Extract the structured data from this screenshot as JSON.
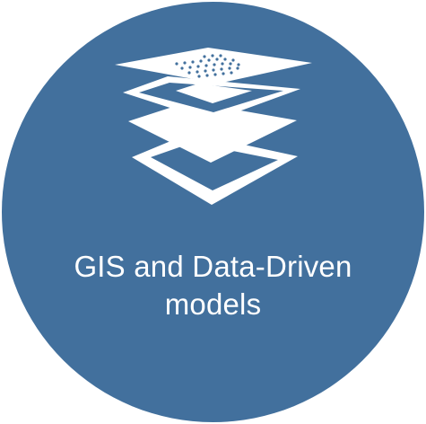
{
  "badge": {
    "background_color": "#42709d",
    "icon": "layers-icon",
    "icon_color": "#ffffff",
    "caption_lines": [
      "GIS and Data-Driven",
      "models"
    ]
  }
}
